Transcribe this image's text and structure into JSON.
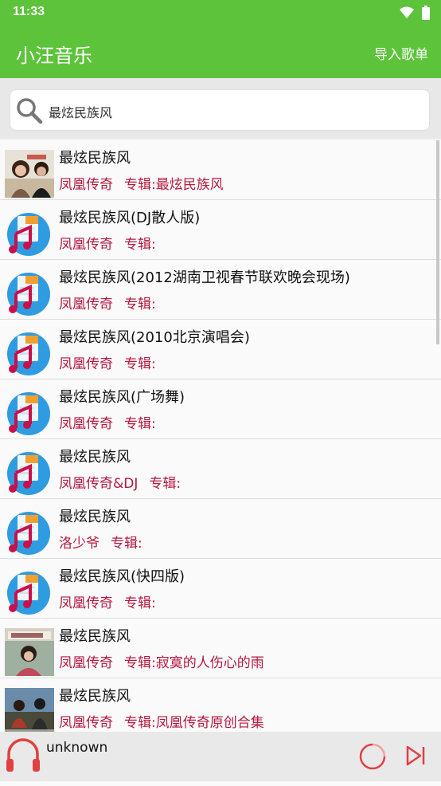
{
  "status": {
    "time": "11:33"
  },
  "appbar": {
    "title": "小汪音乐",
    "import_label": "导入歌单"
  },
  "search": {
    "query": "最炫民族风"
  },
  "songs": [
    {
      "title": "最炫民族风",
      "artist": "凤凰传奇",
      "album": "专辑:最炫民族风",
      "thumb": "photo-a"
    },
    {
      "title": "最炫民族风(DJ散人版)",
      "artist": "凤凰传奇",
      "album": "专辑:",
      "thumb": "music-file"
    },
    {
      "title": "最炫民族风(2012湖南卫视春节联欢晚会现场)",
      "artist": "凤凰传奇",
      "album": "专辑:",
      "thumb": "music-file"
    },
    {
      "title": "最炫民族风(2010北京演唱会)",
      "artist": "凤凰传奇",
      "album": "专辑:",
      "thumb": "music-file"
    },
    {
      "title": "最炫民族风(广场舞)",
      "artist": "凤凰传奇",
      "album": "专辑:",
      "thumb": "music-file"
    },
    {
      "title": "最炫民族风",
      "artist": "凤凰传奇&DJ",
      "album": "专辑:",
      "thumb": "music-file"
    },
    {
      "title": "最炫民族风",
      "artist": "洛少爷",
      "album": "专辑:",
      "thumb": "music-file"
    },
    {
      "title": "最炫民族风(快四版)",
      "artist": "凤凰传奇",
      "album": "专辑:",
      "thumb": "music-file"
    },
    {
      "title": "最炫民族风",
      "artist": "凤凰传奇",
      "album": "专辑:寂寞的人伤心的雨",
      "thumb": "photo-b"
    },
    {
      "title": "最炫民族风",
      "artist": "凤凰传奇",
      "album": "专辑:凤凰传奇原创合集",
      "thumb": "photo-c"
    }
  ],
  "player": {
    "track": "unknown"
  },
  "colors": {
    "brand": "#5cc33b",
    "artist_text": "#b5183f",
    "icon_red": "#e04040"
  }
}
